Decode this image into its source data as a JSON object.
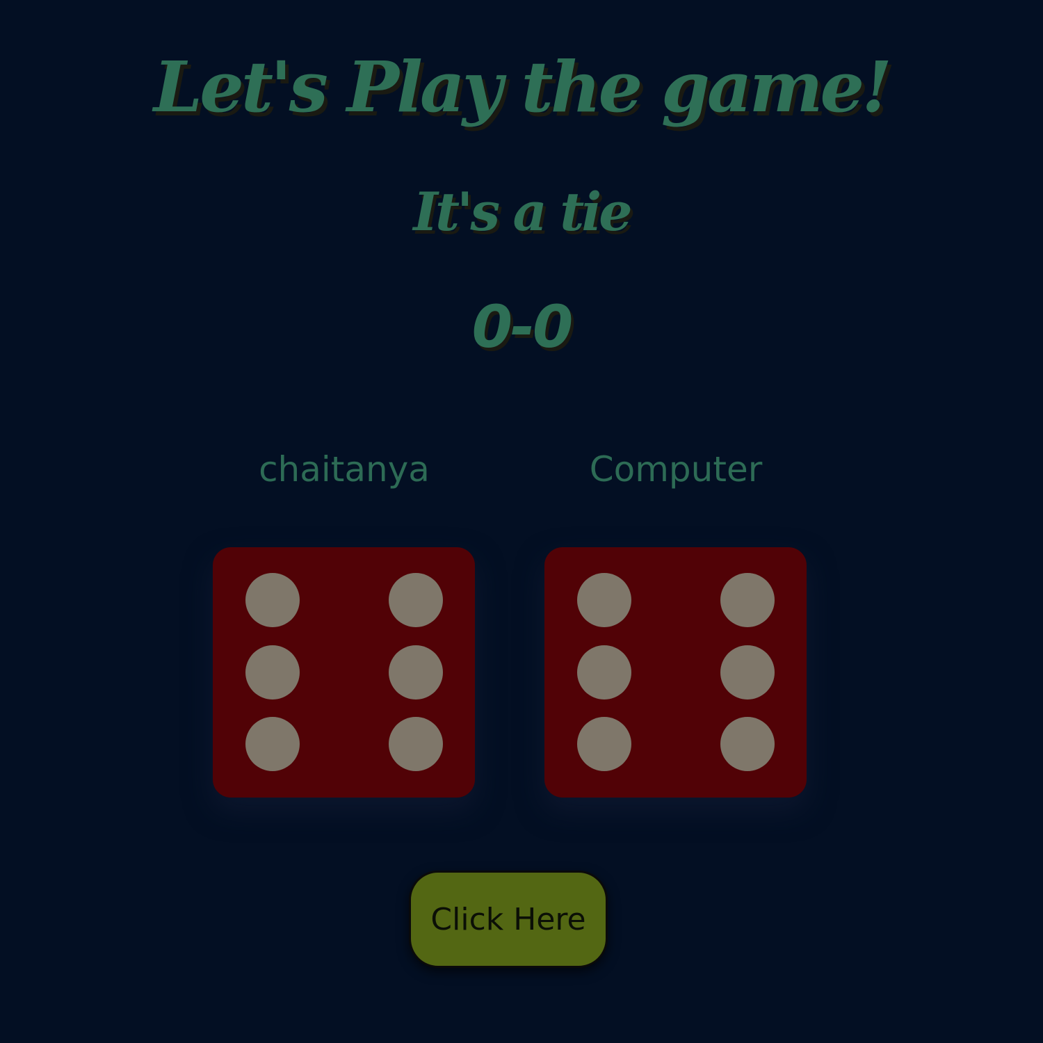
{
  "game": {
    "title": "Let's Play the game!",
    "status": "It's a tie",
    "score": "0-0"
  },
  "players": [
    {
      "name": "chaitanya",
      "die_value": 6
    },
    {
      "name": "Computer",
      "die_value": 6
    }
  ],
  "button": {
    "label": "Click Here"
  },
  "colors": {
    "background": "#030f23",
    "text_accent": "#2e6f56",
    "die_face": "#510206",
    "die_pip": "#7f776a",
    "button_bg": "#536713"
  }
}
